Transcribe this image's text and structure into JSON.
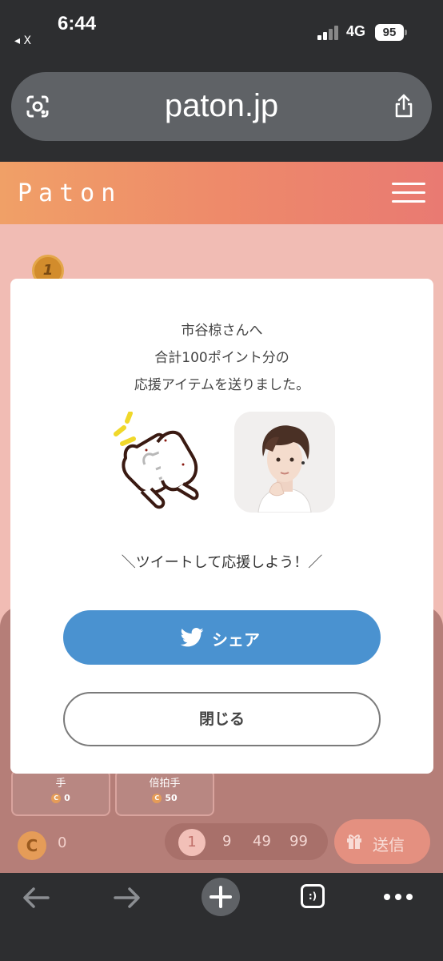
{
  "status_bar": {
    "time": "6:44",
    "back_app": "◂ X",
    "network": "4G",
    "battery": "95"
  },
  "browser": {
    "url": "paton.jp"
  },
  "site": {
    "logo": "Paton",
    "rank_badge": "1"
  },
  "background_ui": {
    "items": [
      {
        "name": "手",
        "price": "0"
      },
      {
        "name": "倍拍手",
        "price": "50"
      }
    ],
    "wallet_icon": "C",
    "wallet_balance": "0",
    "amounts": [
      "1",
      "9",
      "49",
      "99"
    ],
    "selected_amount": "1",
    "send_label": "送信"
  },
  "modal": {
    "line1": "市谷椋さんへ",
    "line2": "合計100ポイント分の",
    "line3": "応援アイテムを送りました。",
    "tweet_prompt": "＼ツイートして応援しよう！／",
    "share_label": "シェア",
    "close_label": "閉じる",
    "item_icon": "clapping-hands-icon"
  },
  "toolbar": {
    "tabs_label": ":)"
  },
  "colors": {
    "header_gradient_start": "#f0a067",
    "header_gradient_end": "#e97a72",
    "twitter_blue": "#4a92d0",
    "browser_chrome": "#2d2e30"
  }
}
